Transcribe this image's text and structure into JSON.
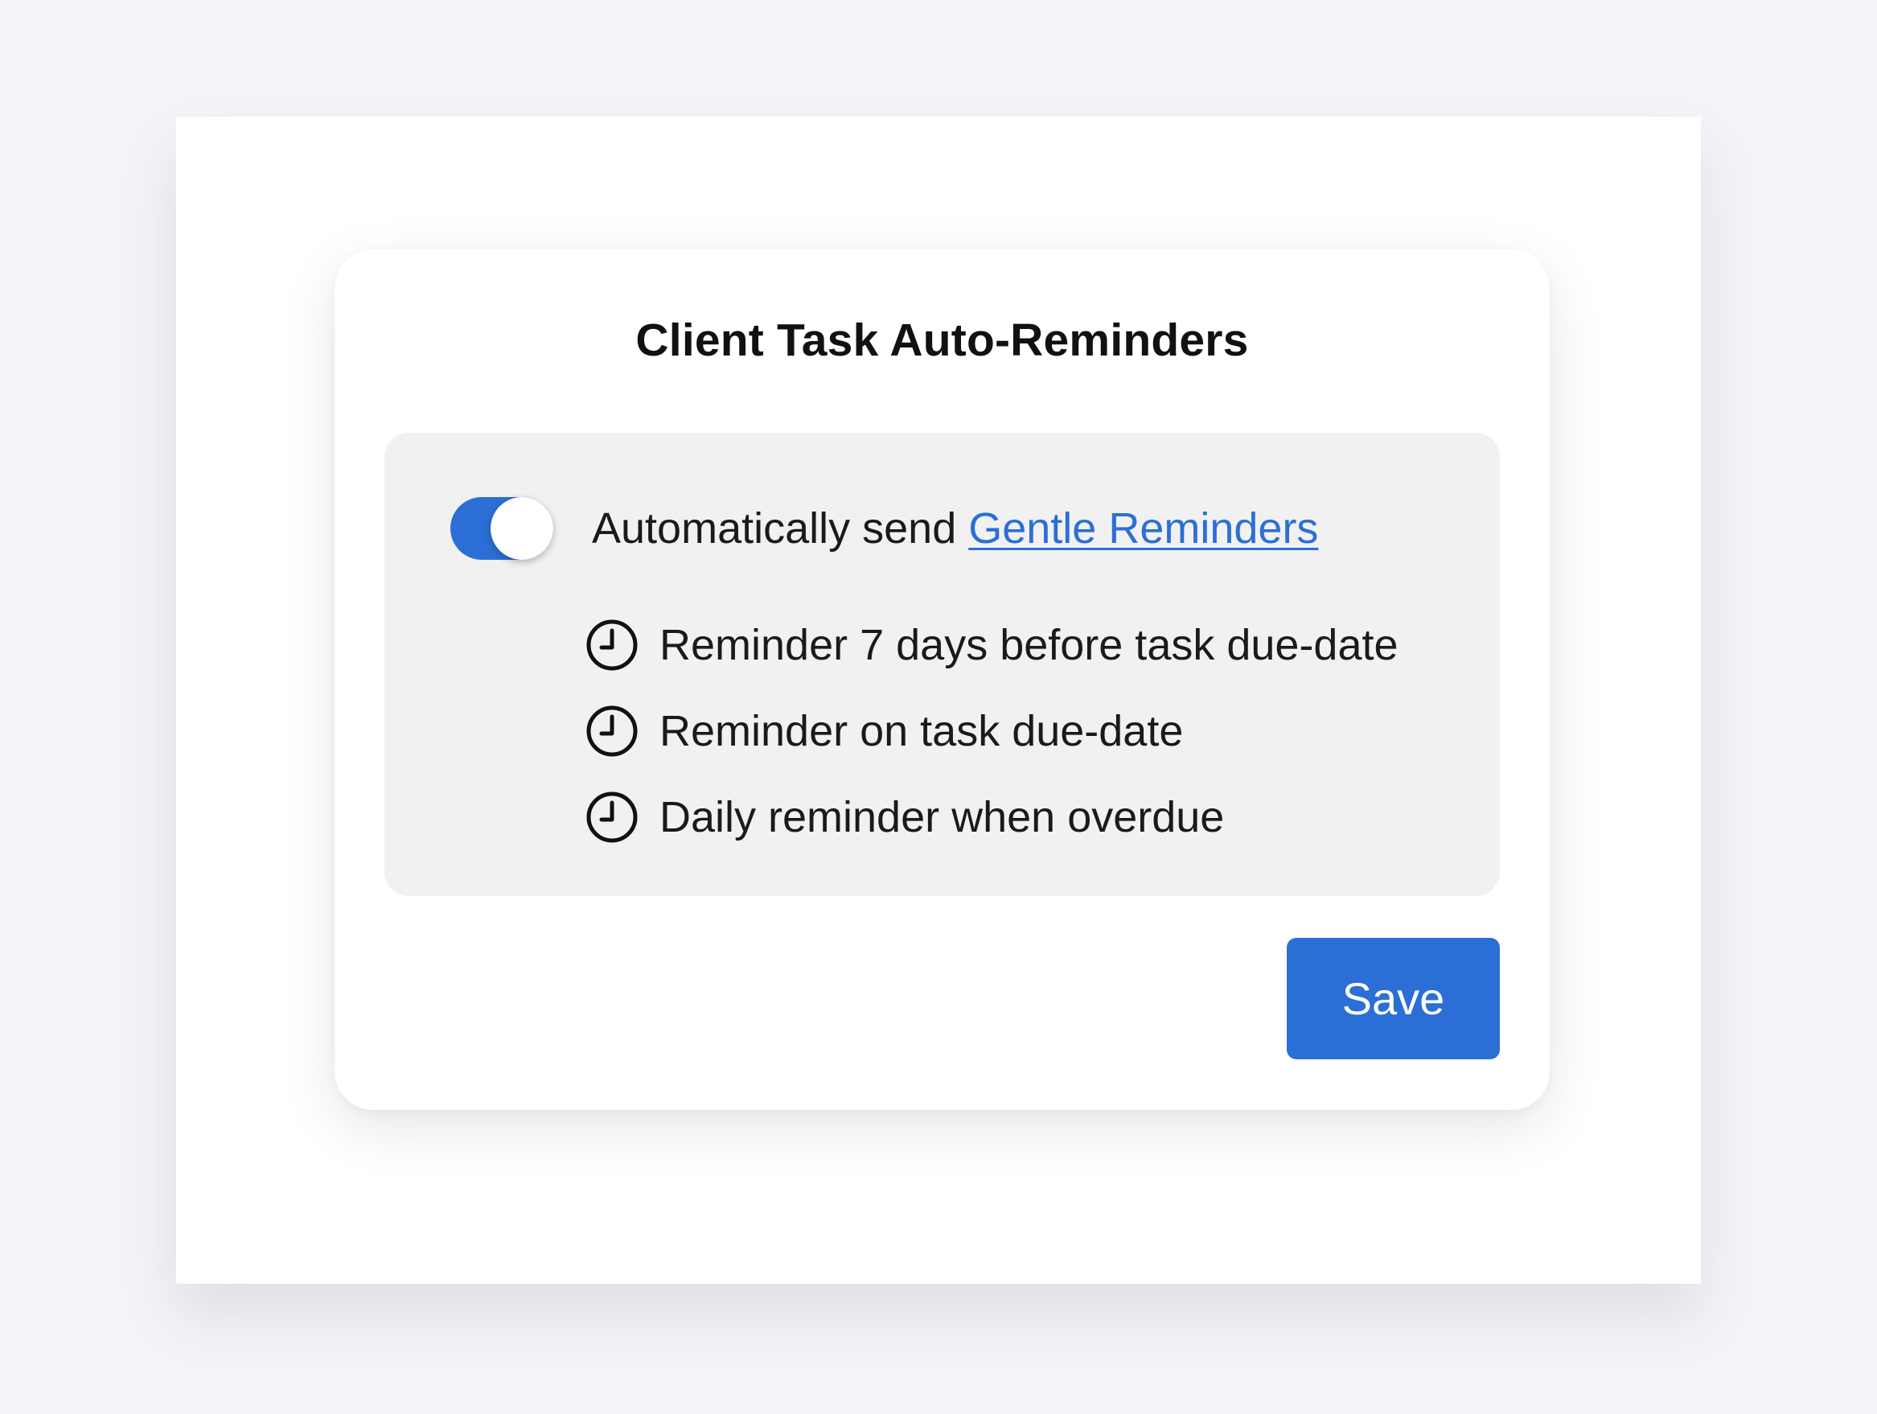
{
  "dialog": {
    "title": "Client Task Auto-Reminders"
  },
  "toggle_row": {
    "enabled": true,
    "label_prefix": "Automatically send ",
    "link_label": "Gentle Reminders"
  },
  "reminders": [
    {
      "icon": "clock-icon",
      "label": "Reminder 7 days before task due-date"
    },
    {
      "icon": "clock-icon",
      "label": "Reminder on task due-date"
    },
    {
      "icon": "clock-icon",
      "label": "Daily reminder when overdue"
    }
  ],
  "actions": {
    "save_label": "Save"
  },
  "colors": {
    "accent": "#2b6fd6",
    "page_background": "#f3f4f7",
    "panel_background": "#f1f1f2",
    "card_background": "#ffffff",
    "text": "#1a1a1a"
  }
}
